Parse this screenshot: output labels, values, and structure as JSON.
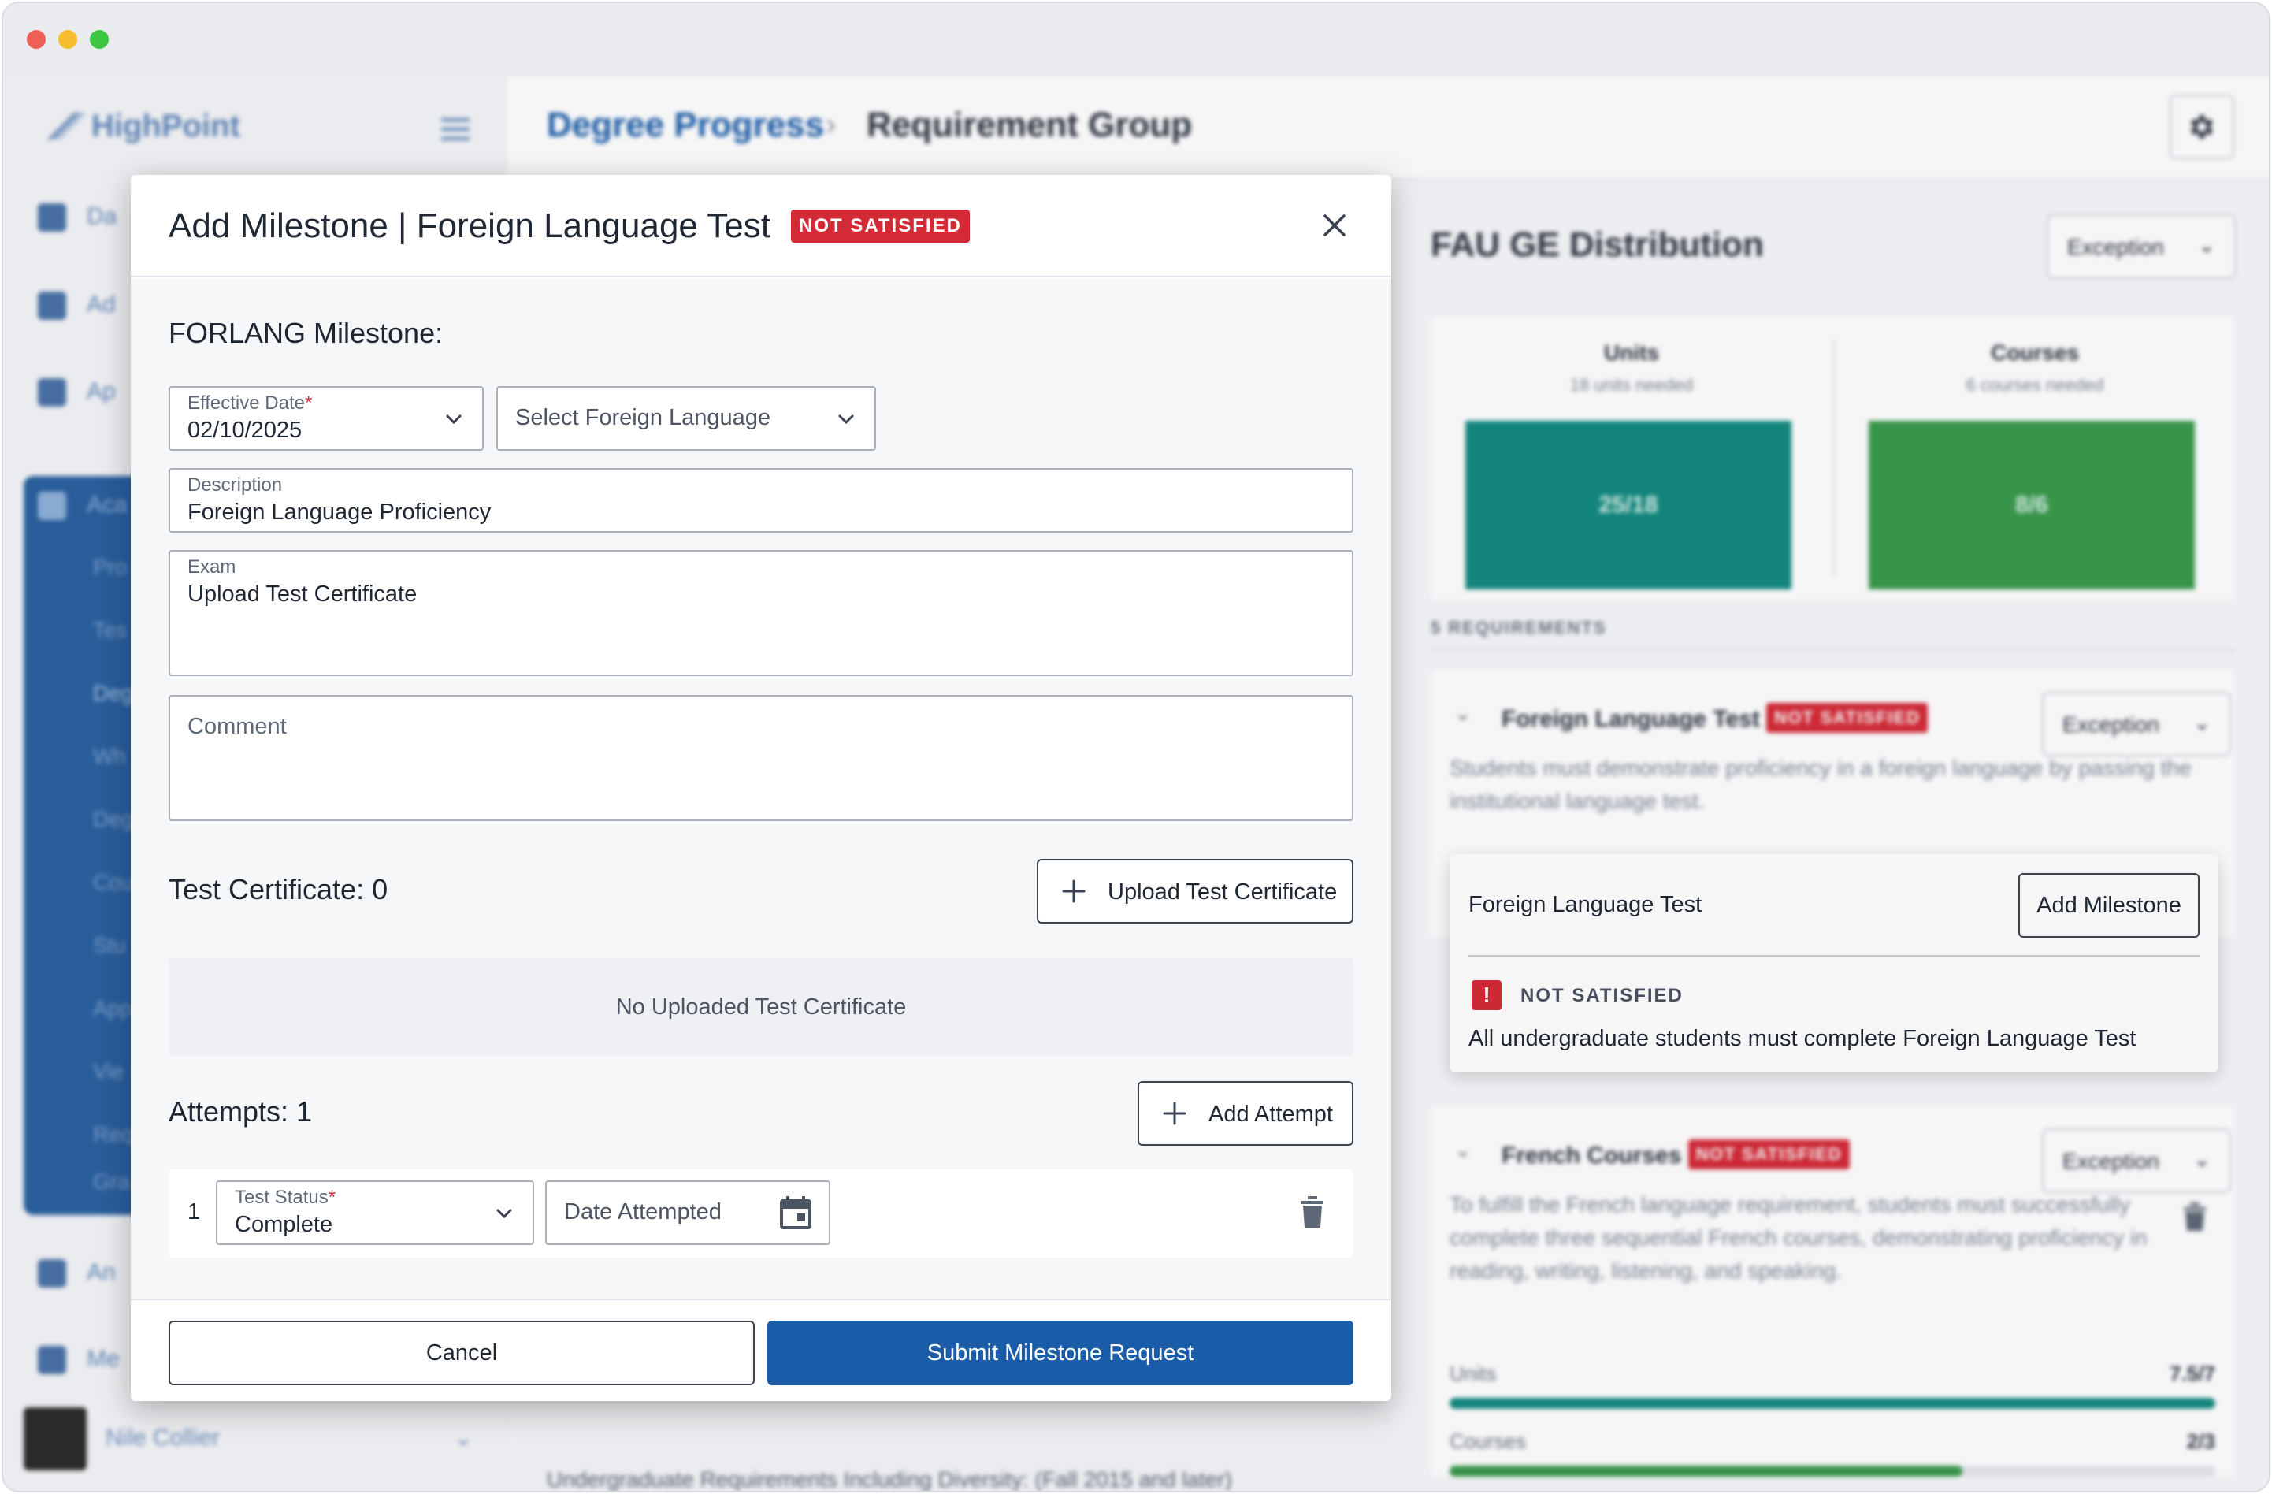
{
  "sidebar": {
    "logo_text": "HighPoint",
    "top_items": [
      {
        "label": "Da"
      },
      {
        "label": "Ad"
      },
      {
        "label": "Ap"
      }
    ],
    "group_label": "Aca",
    "sub_items": [
      {
        "label": "Pro"
      },
      {
        "label": "Tes"
      },
      {
        "label": "Deg"
      },
      {
        "label": "Wh"
      },
      {
        "label": "Deg"
      },
      {
        "label": "Cou"
      },
      {
        "label": "Stu"
      },
      {
        "label": "App"
      },
      {
        "label": "Vie"
      },
      {
        "label": "Req"
      },
      {
        "label": "Gra"
      }
    ],
    "bottom_items": [
      {
        "label": "An"
      },
      {
        "label": "Me"
      }
    ],
    "user_name": "Nile Collier"
  },
  "header": {
    "breadcrumb_parent": "Degree Progress",
    "breadcrumb_separator": "›",
    "breadcrumb_current": "Requirement Group"
  },
  "background": {
    "left_card_text": "Undergraduate Requirements Including Diversity: (Fall 2015 and later)"
  },
  "right_panel": {
    "title": "FAU GE Distribution",
    "exception_label": "Exception",
    "stats": [
      {
        "title": "Units",
        "subtitle": "18 units needed",
        "value": "25/18",
        "color": "#138a7f"
      },
      {
        "title": "Courses",
        "subtitle": "6 courses needed",
        "value": "8/6",
        "color": "#3a9a4a"
      }
    ],
    "requirements_label": "5 REQUIREMENTS",
    "requirements": [
      {
        "title": "Foreign Language Test",
        "status": "NOT SATISFIED",
        "exception_label": "Exception",
        "description": "Students must demonstrate proficiency in a foreign language by passing the institutional language test."
      },
      {
        "title": "French Courses",
        "status": "NOT SATISFIED",
        "exception_label": "Exception",
        "description": "To fulfill the French language requirement, students must successfully complete three sequential French courses, demonstrating proficiency in reading, writing, listening, and speaking.",
        "bars": [
          {
            "label": "Units",
            "value": "7.5/7",
            "fraction": 1.0,
            "color": "#138a7f"
          },
          {
            "label": "Courses",
            "value": "2/3",
            "fraction": 0.67,
            "color": "#3a9a4a"
          }
        ]
      }
    ]
  },
  "popover": {
    "title": "Foreign Language Test",
    "add_button": "Add Milestone",
    "status": "NOT SATISFIED",
    "message": "All undergraduate students must complete Foreign Language Test"
  },
  "modal": {
    "title": "Add Milestone | Foreign Language Test",
    "badge": "NOT SATISFIED",
    "section_title": "FORLANG Milestone:",
    "effective_date": {
      "label": "Effective Date",
      "required_mark": "*",
      "value": "02/10/2025"
    },
    "language_select": {
      "placeholder": "Select Foreign Language"
    },
    "description": {
      "label": "Description",
      "value": "Foreign Language Proficiency"
    },
    "exam": {
      "label": "Exam",
      "value": "Upload Test Certificate"
    },
    "comment": {
      "placeholder": "Comment"
    },
    "certificates": {
      "title": "Test Certificate: 0",
      "upload_button": "Upload Test Certificate",
      "empty_text": "No Uploaded Test Certificate"
    },
    "attempts": {
      "title": "Attempts: 1",
      "add_button": "Add Attempt",
      "rows": [
        {
          "number": "1",
          "status_label": "Test Status",
          "required_mark": "*",
          "status_value": "Complete",
          "date_placeholder": "Date Attempted"
        }
      ]
    },
    "footer": {
      "cancel": "Cancel",
      "submit": "Submit Milestone Request"
    }
  }
}
